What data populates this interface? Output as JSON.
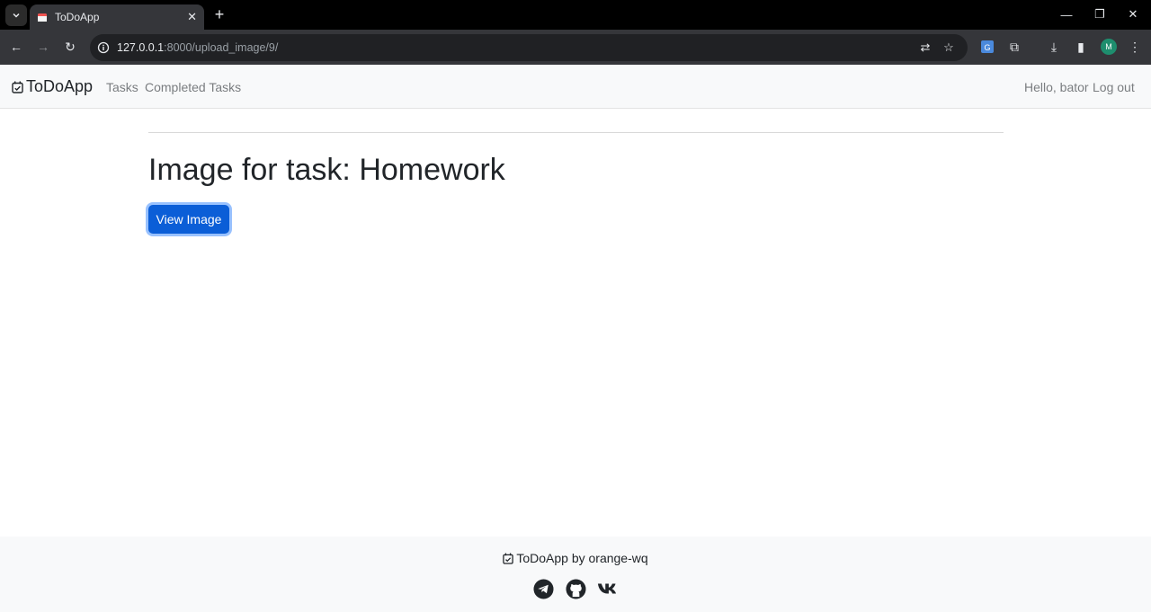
{
  "browser": {
    "tab_title": "ToDoApp",
    "url_host": "127.0.0.1",
    "url_rest": ":8000/upload_image/9/",
    "profile_initial": "M"
  },
  "navbar": {
    "brand": "ToDoApp",
    "links": [
      "Tasks",
      "Completed Tasks"
    ],
    "greeting": "Hello, bator",
    "logout": "Log out"
  },
  "main": {
    "heading": "Image for task: Homework",
    "view_button": "View Image"
  },
  "footer": {
    "text": "ToDoApp by orange-wq",
    "socials": [
      "telegram-icon",
      "github-icon",
      "vk-icon"
    ]
  },
  "colors": {
    "primary": "#0b5ed7",
    "navbar_bg": "#f8f9fa"
  }
}
